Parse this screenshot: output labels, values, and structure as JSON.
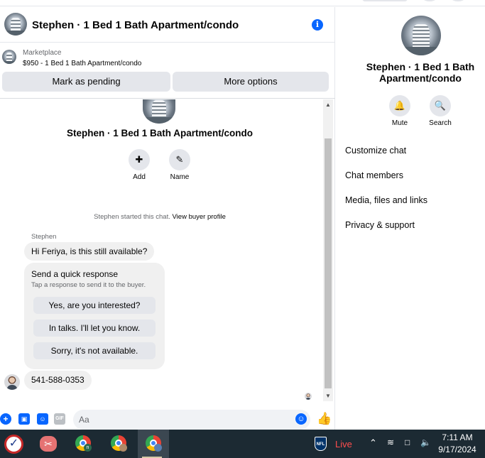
{
  "header": {
    "title": "Stephen · 1 Bed 1 Bath Apartment/condo",
    "info_icon": "info-icon"
  },
  "marketplace": {
    "label": "Marketplace",
    "listing": "$950 - 1 Bed 1 Bath Apartment/condo",
    "mark_pending": "Mark as pending",
    "more_options": "More options"
  },
  "conversation": {
    "title": "Stephen · 1 Bed 1 Bath Apartment/condo",
    "add_label": "Add",
    "name_label": "Name",
    "started_text": "Stephen started this chat.",
    "view_profile": "View buyer profile",
    "sender": "Stephen",
    "message1": "Hi Feriya, is this still available?",
    "quick_title": "Send a quick response",
    "quick_sub": "Tap a response to send it to the buyer.",
    "quick_replies": [
      "Yes, are you interested?",
      "In talks. I'll let you know.",
      "Sorry, it's not available."
    ],
    "message2": "541-588-0353"
  },
  "composer": {
    "placeholder": "Aa"
  },
  "side": {
    "title": "Stephen · 1 Bed 1 Bath Apartment/condo",
    "mute": "Mute",
    "search": "Search",
    "items": [
      "Customize chat",
      "Chat members",
      "Media, files and links",
      "Privacy & support"
    ]
  },
  "taskbar": {
    "live": "Live",
    "nfl": "NFL",
    "time": "7:11 AM",
    "date": "9/17/2024"
  },
  "colors": {
    "accent": "#0866ff",
    "bubble": "#f0f0f0",
    "button": "#e4e6eb",
    "taskbar": "#1c2a33",
    "live": "#ff4d4d"
  }
}
